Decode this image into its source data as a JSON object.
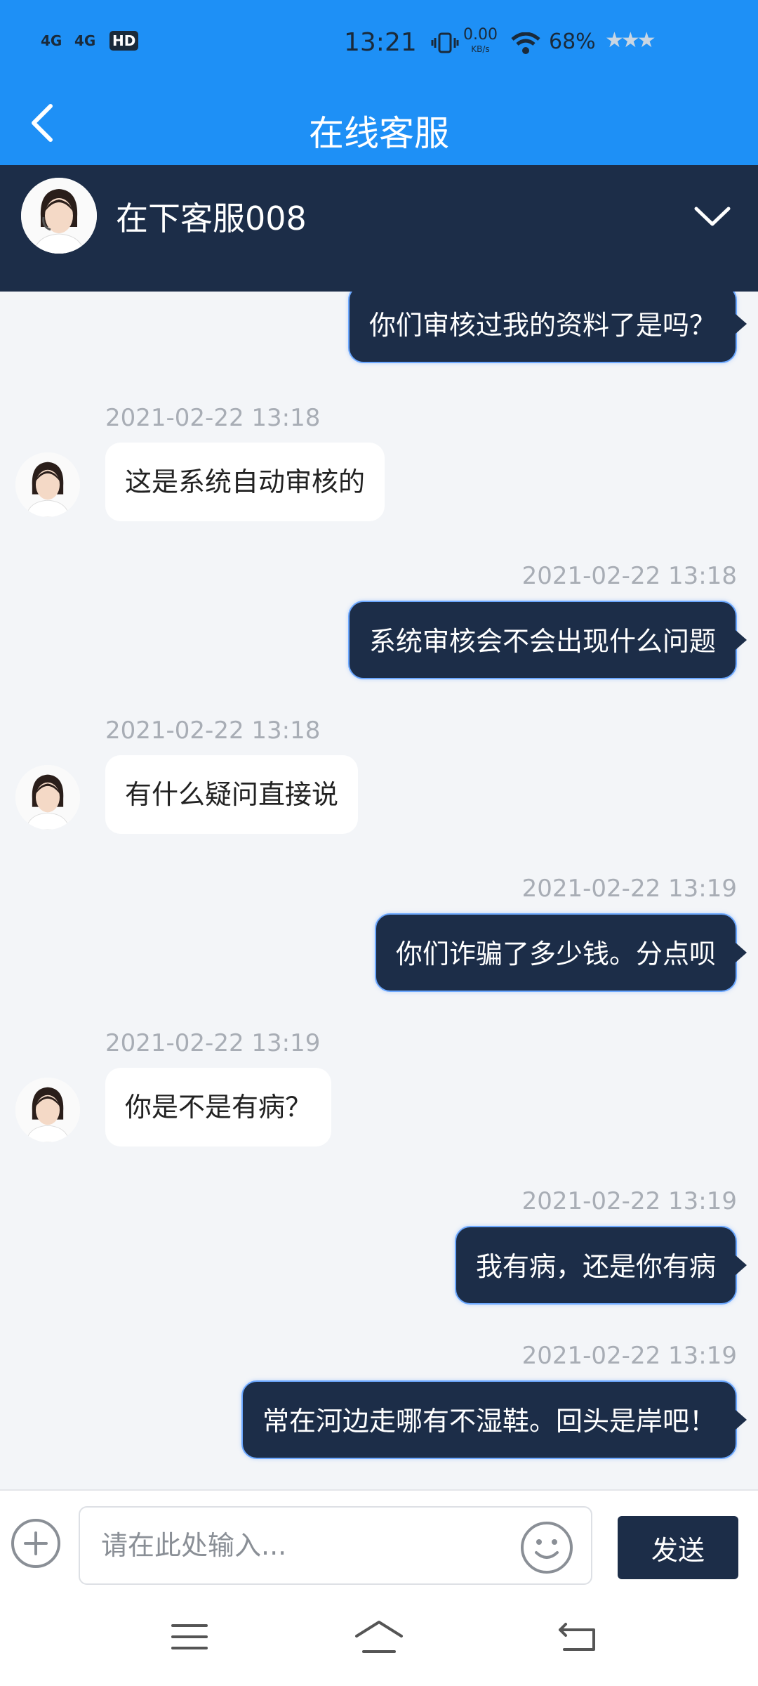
{
  "status_bar": {
    "signal_1": "4G",
    "signal_2": "4G",
    "hd_badge": "HD",
    "time": "13:21",
    "net_speed": "0.00",
    "net_unit": "KB/s",
    "battery": "68%"
  },
  "header": {
    "title": "在线客服",
    "back_icon": "chevron-left-icon"
  },
  "agent": {
    "name": "在下客服008",
    "collapse_icon": "chevron-down-icon"
  },
  "messages": [
    {
      "side": "out",
      "time": "",
      "text": "你们审核过我的资料了是吗？"
    },
    {
      "side": "in",
      "time": "2021-02-22 13:18",
      "text": "这是系统自动审核的"
    },
    {
      "side": "out",
      "time": "2021-02-22 13:18",
      "text": "系统审核会不会出现什么问题"
    },
    {
      "side": "in",
      "time": "2021-02-22 13:18",
      "text": "有什么疑问直接说"
    },
    {
      "side": "out",
      "time": "2021-02-22 13:19",
      "text": "你们诈骗了多少钱。分点呗"
    },
    {
      "side": "in",
      "time": "2021-02-22 13:19",
      "text": "你是不是有病？"
    },
    {
      "side": "out",
      "time": "2021-02-22 13:19",
      "text": "我有病，还是你有病"
    },
    {
      "side": "out",
      "time": "2021-02-22 13:19",
      "text": "常在河边走哪有不湿鞋。回头是岸吧！"
    }
  ],
  "input": {
    "placeholder": "请在此处输入...",
    "send_label": "发送"
  },
  "colors": {
    "topbar": "#1e90f6",
    "navy": "#1c2d48",
    "bubble_glow": "#6ca8ff"
  }
}
